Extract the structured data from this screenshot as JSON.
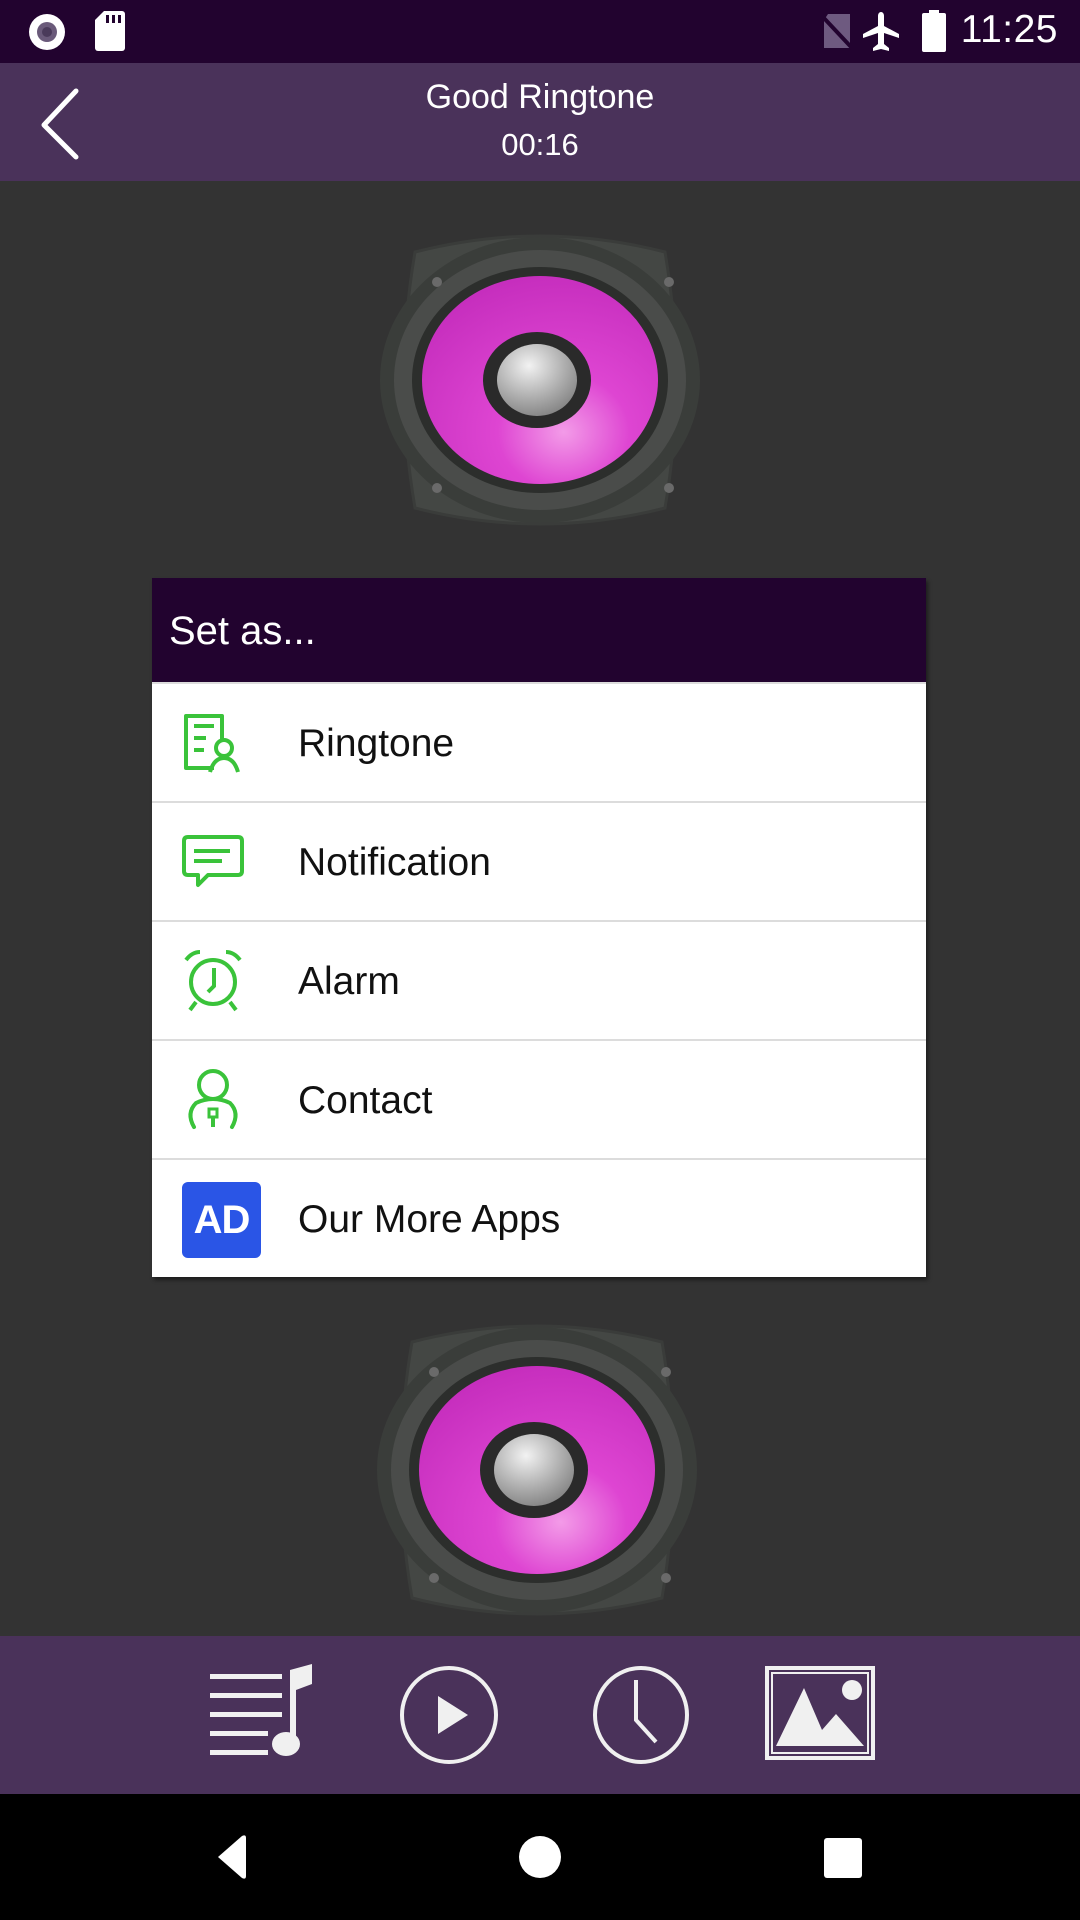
{
  "status_bar": {
    "time": "11:25",
    "left_icons": [
      "record-icon",
      "sd-card-icon"
    ],
    "right_icons": [
      "no-sim-icon",
      "airplane-mode-icon",
      "battery-full-icon"
    ]
  },
  "app_bar": {
    "title": "Good Ringtone",
    "duration": "00:16",
    "back_icon": "chevron-left-icon"
  },
  "dialog": {
    "title": "Set as...",
    "items": [
      {
        "label": "Ringtone",
        "icon": "ringtone-contact-card-icon"
      },
      {
        "label": "Notification",
        "icon": "message-bubble-icon"
      },
      {
        "label": "Alarm",
        "icon": "alarm-clock-icon"
      },
      {
        "label": "Contact",
        "icon": "person-icon"
      },
      {
        "label": "Our More Apps",
        "icon": "ad-badge-icon",
        "badge_text": "AD"
      }
    ]
  },
  "toolbar": {
    "buttons": [
      {
        "name": "playlist",
        "icon": "playlist-music-icon"
      },
      {
        "name": "play",
        "icon": "play-circle-icon"
      },
      {
        "name": "history",
        "icon": "clock-icon"
      },
      {
        "name": "wallpaper",
        "icon": "image-icon"
      }
    ]
  },
  "nav_bar": {
    "buttons": [
      "back-triangle-icon",
      "home-circle-icon",
      "recents-square-icon"
    ]
  },
  "colors": {
    "status_bar_bg": "#22032f",
    "app_bar_bg": "#4a325a",
    "page_bg": "#333333",
    "accent_green": "#3ac33a",
    "speaker_cone": "#d63ccc",
    "ad_blue": "#2a55e6"
  }
}
